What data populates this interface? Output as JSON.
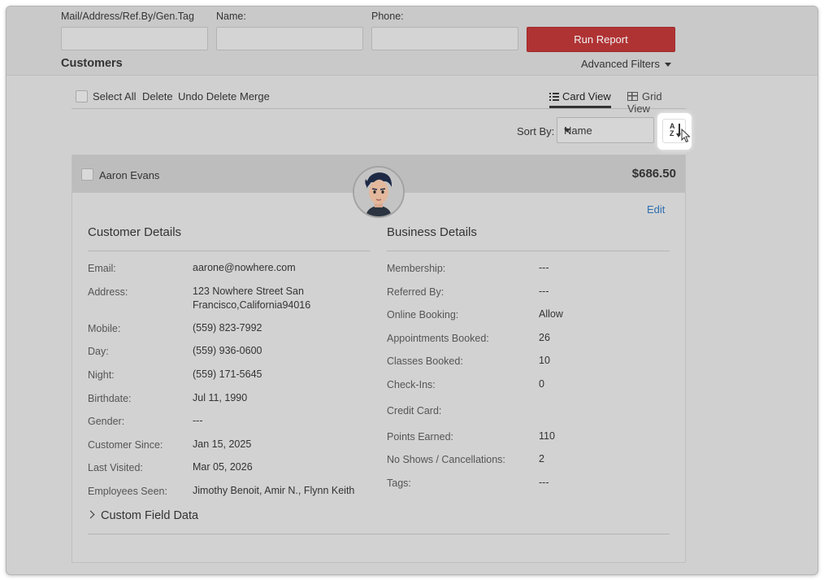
{
  "filters": {
    "mail_label": "Mail/Address/Ref.By/Gen.Tag",
    "name_label": "Name:",
    "phone_label": "Phone:",
    "mail_value": "",
    "name_value": "",
    "phone_value": "",
    "run_report": "Run Report",
    "advanced_filters": "Advanced Filters"
  },
  "page_title": "Customers",
  "toolbar": {
    "select_all": "Select All",
    "delete": "Delete",
    "undo_delete": "Undo Delete",
    "merge": "Merge",
    "card_view": "Card View",
    "grid_view": "Grid View"
  },
  "sort": {
    "label": "Sort By:",
    "selected": "Name",
    "az_top": "A",
    "az_bottom": "Z"
  },
  "customer": {
    "name": "Aaron Evans",
    "amount": "$686.50",
    "edit": "Edit",
    "customer_details_title": "Customer Details",
    "business_details_title": "Business Details",
    "customer_details": [
      {
        "label": "Email:",
        "value": "aarone@nowhere.com"
      },
      {
        "label": "Address:",
        "value": "123 Nowhere Street San Francisco,California94016"
      },
      {
        "label": "Mobile:",
        "value": "(559) 823-7992"
      },
      {
        "label": "Day:",
        "value": "(559) 936-0600"
      },
      {
        "label": "Night:",
        "value": "(559) 171-5645"
      },
      {
        "label": "Birthdate:",
        "value": "Jul 11, 1990"
      },
      {
        "label": "Gender:",
        "value": "---"
      },
      {
        "label": "Customer Since:",
        "value": "Jan 15, 2025"
      },
      {
        "label": "Last Visited:",
        "value": "Mar 05, 2026"
      },
      {
        "label": "Employees Seen:",
        "value": "Jimothy Benoit, Amir N., Flynn Keith"
      }
    ],
    "business_details": [
      {
        "label": "Membership:",
        "value": "---"
      },
      {
        "label": "Referred By:",
        "value": "---"
      },
      {
        "label": "Online Booking:",
        "value": "Allow"
      },
      {
        "label": "Appointments Booked:",
        "value": "26"
      },
      {
        "label": "Classes Booked:",
        "value": "10"
      },
      {
        "label": "Check-Ins:",
        "value": "0"
      },
      {
        "label": "Credit Card:",
        "value": ""
      },
      {
        "label": "Points Earned:",
        "value": "110"
      },
      {
        "label": "No Shows / Cancellations:",
        "value": "2"
      },
      {
        "label": "Tags:",
        "value": "---"
      }
    ],
    "custom_field_data": "Custom Field Data"
  },
  "colors": {
    "run_report_bg": "#b03334",
    "edit_link": "#2d6fb0"
  },
  "icons": [
    "list-icon",
    "grid-icon",
    "sort-az-icon",
    "chevron-right-icon",
    "caret-down-icon",
    "mouse-cursor-icon"
  ]
}
